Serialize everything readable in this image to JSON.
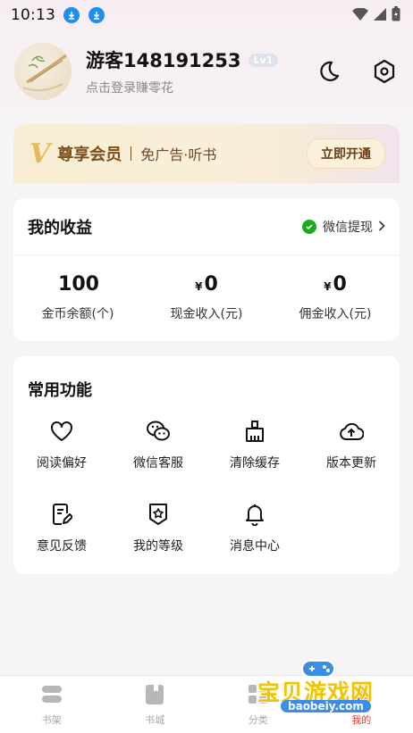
{
  "status_bar": {
    "time": "10:13"
  },
  "profile": {
    "username": "游客148191253",
    "level": "Lv1",
    "subtitle": "点击登录赚零花"
  },
  "vip": {
    "title": "尊享会员",
    "benefits": "免广告·听书",
    "button": "立即开通"
  },
  "earnings": {
    "title": "我的收益",
    "withdraw_label": "微信提现",
    "stats": [
      {
        "currency": "",
        "value": "100",
        "label": "金币余额(个)"
      },
      {
        "currency": "¥",
        "value": "0",
        "label": "现金收入(元)"
      },
      {
        "currency": "¥",
        "value": "0",
        "label": "佣金收入(元)"
      }
    ]
  },
  "functions": {
    "title": "常用功能",
    "items": [
      {
        "label": "阅读偏好",
        "icon": "heart-icon"
      },
      {
        "label": "微信客服",
        "icon": "wechat-icon"
      },
      {
        "label": "清除缓存",
        "icon": "broom-icon"
      },
      {
        "label": "版本更新",
        "icon": "cloud-upload-icon"
      },
      {
        "label": "意见反馈",
        "icon": "feedback-icon"
      },
      {
        "label": "我的等级",
        "icon": "level-star-icon"
      },
      {
        "label": "消息中心",
        "icon": "bell-icon"
      }
    ]
  },
  "bottom_nav": {
    "items": [
      {
        "label": "书架",
        "icon": "bookshelf-icon",
        "active": false
      },
      {
        "label": "书城",
        "icon": "book-store-icon",
        "active": false
      },
      {
        "label": "分类",
        "icon": "category-icon",
        "active": false
      },
      {
        "label": "我的",
        "icon": "profile-icon",
        "active": true
      }
    ]
  },
  "watermark": {
    "text": "宝贝游戏网",
    "url": "baobeiy.com"
  },
  "colors": {
    "vip_text": "#7d4e1c",
    "active_tab": "#e53935",
    "wechat_green": "#1aad19"
  }
}
